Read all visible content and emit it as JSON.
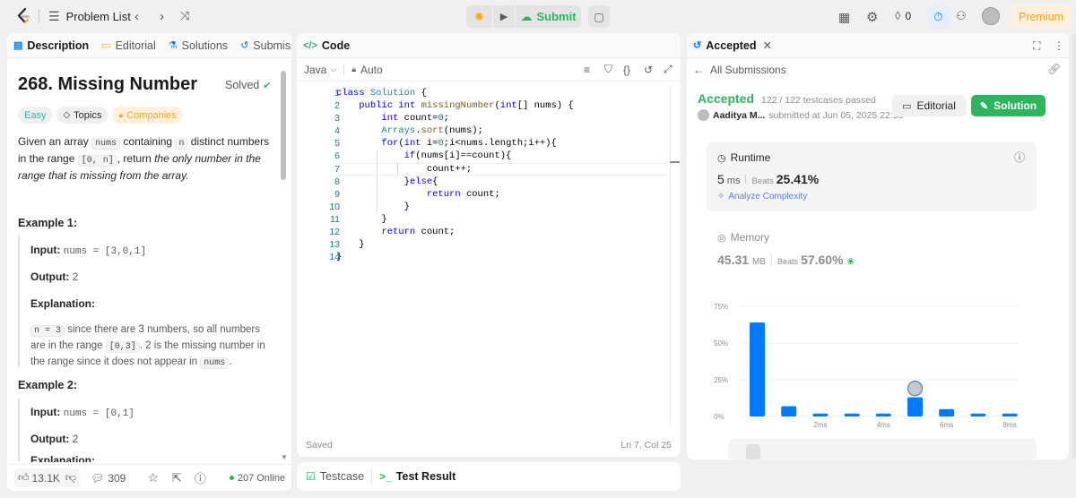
{
  "topbar": {
    "problem_list": "Problem List",
    "submit": "Submit",
    "streak_count": "0",
    "premium": "Premium"
  },
  "left": {
    "tabs": [
      "Description",
      "Editorial",
      "Solutions",
      "Submissio"
    ],
    "title": "268. Missing Number",
    "solved": "Solved",
    "tags": {
      "difficulty": "Easy",
      "topics": "Topics",
      "companies": "Companies"
    },
    "desc": {
      "p1": "Given an array ",
      "c1": "nums",
      "p2": " containing ",
      "c2": "n",
      "p3": " distinct numbers in the range ",
      "c3": "[0, n]",
      "p4": ", return ",
      "em": "the only number in the range that is missing from the array."
    },
    "ex1": {
      "title": "Example 1:",
      "input_label": "Input:",
      "input": "nums = [3,0,1]",
      "output_label": "Output:",
      "output": "2",
      "expl_label": "Explanation:",
      "e_c1": "n = 3",
      "e_t1": " since there are 3 numbers, so all numbers are in the range ",
      "e_c2": "[0,3]",
      "e_t2": ". 2 is the missing number in the range since it does not appear in ",
      "e_c3": "nums",
      "e_t3": "."
    },
    "ex2": {
      "title": "Example 2:",
      "input_label": "Input:",
      "input": "nums = [0,1]",
      "output_label": "Output:",
      "output": "2",
      "expl_label": "Explanation:"
    },
    "footer": {
      "likes": "13.1K",
      "comments": "309",
      "online": "207 Online"
    }
  },
  "code": {
    "header": "Code",
    "language": "Java",
    "auto": "Auto",
    "status": "Saved",
    "cursor": "Ln 7, Col 25",
    "line_numbers": [
      "1",
      "2",
      "3",
      "4",
      "5",
      "6",
      "7",
      "8",
      "9",
      "10",
      "11",
      "12",
      "13",
      "14"
    ]
  },
  "bottom": {
    "testcase": "Testcase",
    "test_result": "Test Result"
  },
  "right": {
    "tab": "Accepted",
    "back": "All Submissions",
    "status": "Accepted",
    "passed": "122 / 122 testcases passed",
    "user": "Aaditya M...",
    "submitted": "submitted at Jun 05, 2025 22:50",
    "editorial_btn": "Editorial",
    "solution_btn": "Solution",
    "runtime": {
      "label": "Runtime",
      "value": "5",
      "unit": "ms",
      "beats_label": "Beats",
      "beats": "25.41%",
      "analyze": "Analyze Complexity"
    },
    "memory": {
      "label": "Memory",
      "value": "45.31",
      "unit": "MB",
      "beats_label": "Beats",
      "beats": "57.60%"
    }
  },
  "chart_data": {
    "type": "bar",
    "yticks": [
      "75%",
      "50%",
      "25%",
      "0%"
    ],
    "xticks": [
      "2ms",
      "4ms",
      "6ms",
      "8ms"
    ],
    "values": [
      64,
      7,
      2,
      2,
      2,
      13,
      5,
      2,
      2
    ],
    "ylim": [
      0,
      75
    ],
    "highlight_index": 5,
    "accent": "#007aff"
  }
}
